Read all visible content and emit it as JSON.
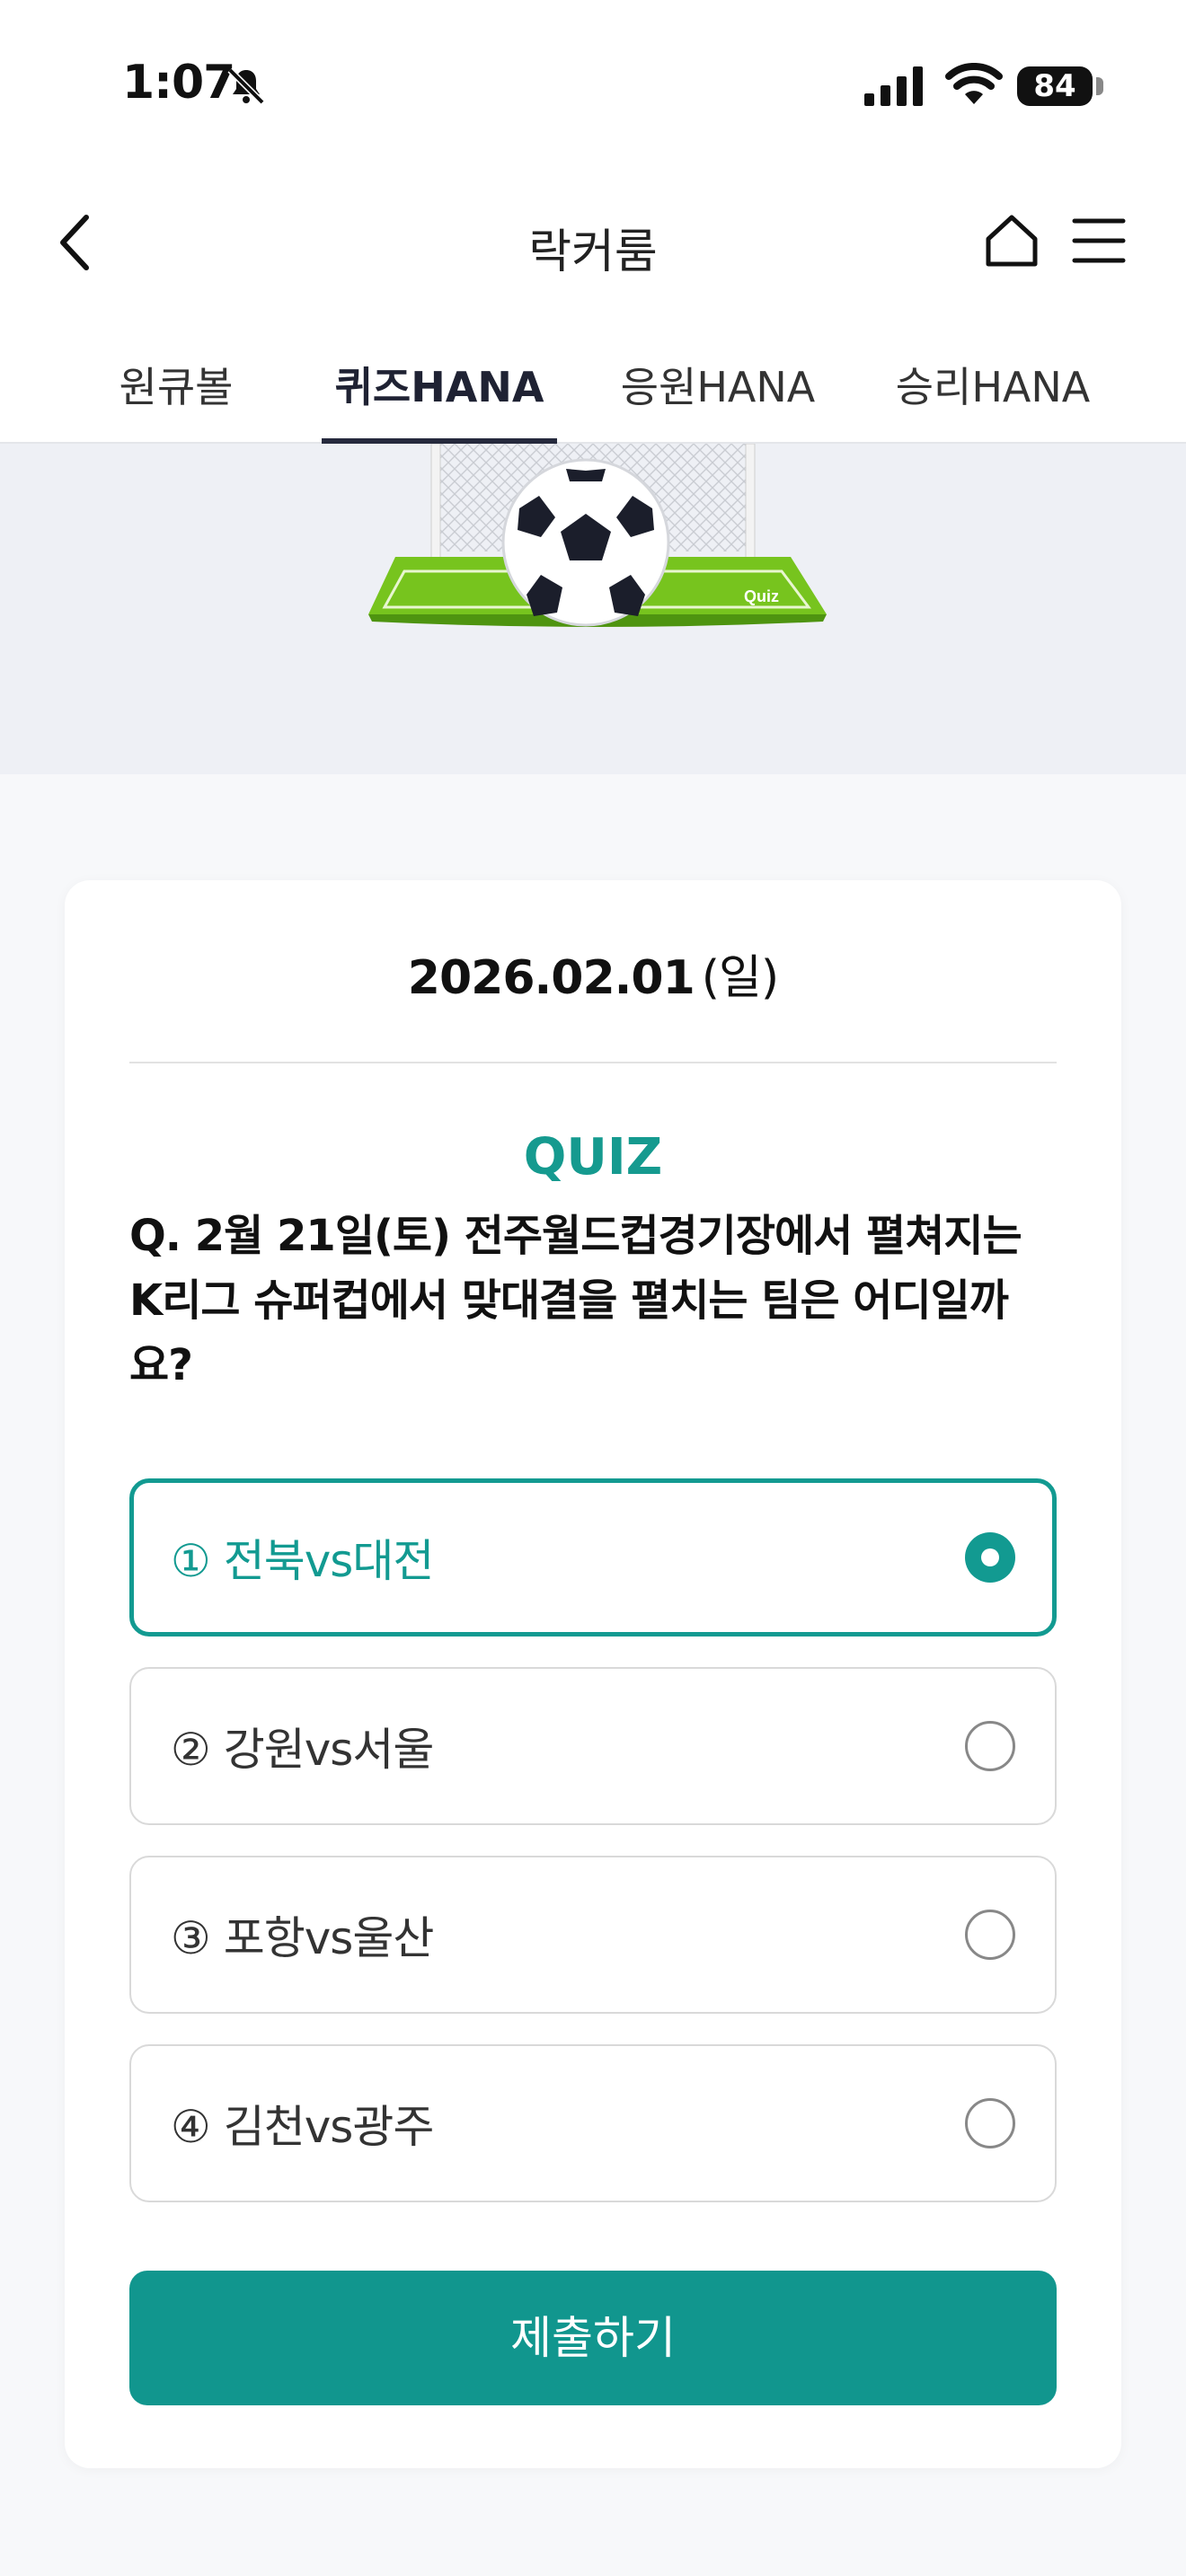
{
  "status_bar": {
    "time": "1:07",
    "battery": "84"
  },
  "header": {
    "title": "락커룸"
  },
  "tabs": [
    {
      "label": "원큐볼"
    },
    {
      "label": "퀴즈HANA",
      "active": true
    },
    {
      "label": "응원HANA"
    },
    {
      "label": "승리HANA"
    }
  ],
  "banner": {
    "goal_text": "Quiz"
  },
  "quiz": {
    "date": "2026.02.01",
    "day_of_week": "(일)",
    "label": "QUIZ",
    "question": "Q. 2월 21일(토) 전주월드컵경기장에서 펼쳐지는 K리그 슈퍼컵에서 맞대결을 펼치는 팀은 어디일까요?",
    "options": [
      {
        "label": "① 전북vs대전",
        "selected": true
      },
      {
        "label": "② 강원vs서울",
        "selected": false
      },
      {
        "label": "③ 포항vs울산",
        "selected": false
      },
      {
        "label": "④ 김천vs광주",
        "selected": false
      }
    ],
    "submit_label": "제출하기"
  },
  "colors": {
    "accent": "#129a91",
    "tab_indicator": "#262a3d",
    "banner_bg": "#eef0f5"
  }
}
